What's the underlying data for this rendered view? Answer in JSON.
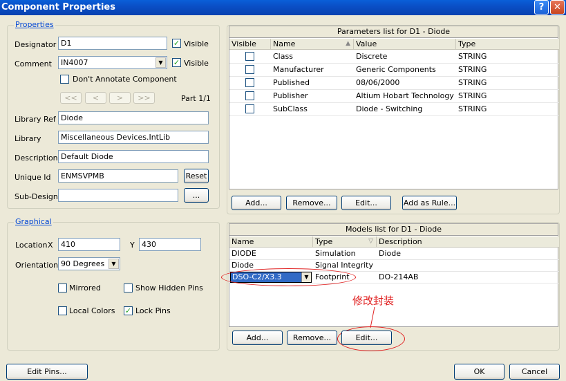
{
  "window": {
    "title": "Component Properties",
    "help_label": "?",
    "close_label": "✕"
  },
  "properties": {
    "legend": "Properties",
    "designator_label": "Designator",
    "designator_value": "D1",
    "visible_label": "Visible",
    "comment_label": "Comment",
    "comment_value": "IN4007",
    "comment_visible_label": "Visible",
    "dont_annotate_label": "Don't Annotate Component",
    "nav_first": "<<",
    "nav_prev": "<",
    "nav_next": ">",
    "nav_last": ">>",
    "part_label": "Part 1/1",
    "library_ref_label": "Library Ref",
    "library_ref_value": "Diode",
    "library_label": "Library",
    "library_value": "Miscellaneous Devices.IntLib",
    "description_label": "Description",
    "description_value": "Default Diode",
    "unique_id_label": "Unique Id",
    "unique_id_value": "ENMSVPMB",
    "reset_label": "Reset",
    "sub_design_label": "Sub-Design",
    "sub_design_value": "",
    "browse_label": "..."
  },
  "graphical": {
    "legend": "Graphical",
    "location_label": "Location",
    "x_label": "X",
    "x_value": "410",
    "y_label": "Y",
    "y_value": "430",
    "orientation_label": "Orientation",
    "orientation_value": "90 Degrees",
    "mirrored_label": "Mirrored",
    "show_hidden_pins_label": "Show Hidden Pins",
    "local_colors_label": "Local Colors",
    "lock_pins_label": "Lock Pins"
  },
  "parameters": {
    "title": "Parameters list for D1 - Diode",
    "columns": [
      "Visible",
      "Name",
      "Value",
      "Type"
    ],
    "rows": [
      {
        "name": "Class",
        "value": "Discrete",
        "type": "STRING"
      },
      {
        "name": "Manufacturer",
        "value": "Generic Components",
        "type": "STRING"
      },
      {
        "name": "Published",
        "value": "08/06/2000",
        "type": "STRING"
      },
      {
        "name": "Publisher",
        "value": "Altium Hobart Technology Cen",
        "type": "STRING"
      },
      {
        "name": "SubClass",
        "value": "Diode - Switching",
        "type": "STRING"
      }
    ],
    "add_label": "Add...",
    "remove_label": "Remove...",
    "edit_label": "Edit...",
    "add_rule_label": "Add as Rule..."
  },
  "models": {
    "title": "Models list for D1 - Diode",
    "columns": [
      "Name",
      "Type",
      "Description"
    ],
    "rows": [
      {
        "name": "DIODE",
        "type": "Simulation",
        "description": "Diode"
      },
      {
        "name": "Diode",
        "type": "Signal Integrity",
        "description": ""
      },
      {
        "name": "DSO-C2/X3.3",
        "type": "Footprint",
        "description": "DO-214AB"
      }
    ],
    "annotation": "修改封装",
    "add_label": "Add...",
    "remove_label": "Remove...",
    "edit_label": "Edit..."
  },
  "footer": {
    "edit_pins_label": "Edit Pins...",
    "ok_label": "OK",
    "cancel_label": "Cancel"
  }
}
